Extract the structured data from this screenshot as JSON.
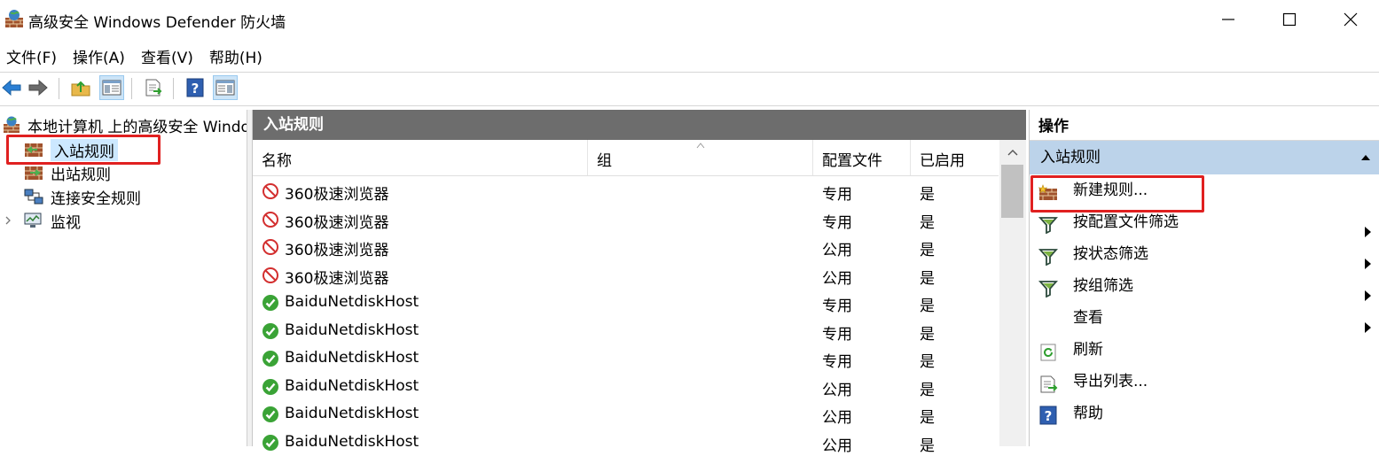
{
  "window": {
    "title": "高级安全 Windows Defender 防火墙"
  },
  "menu": [
    "文件(F)",
    "操作(A)",
    "查看(V)",
    "帮助(H)"
  ],
  "toolbar": {
    "buttons": [
      "back-icon",
      "forward-icon",
      "up-folder-icon",
      "show-hide-tree-icon",
      "export-list-icon",
      "help-icon",
      "show-hide-action-pane-icon"
    ]
  },
  "tree": {
    "root": "本地计算机 上的高级安全 Windows Defender 防火墙",
    "items": [
      {
        "label": "入站规则",
        "selected": true
      },
      {
        "label": "出站规则",
        "selected": false
      },
      {
        "label": "连接安全规则",
        "selected": false
      },
      {
        "label": "监视",
        "selected": false
      }
    ]
  },
  "main": {
    "header": "入站规则",
    "columns": [
      "名称",
      "组",
      "配置文件",
      "已启用"
    ],
    "rows": [
      {
        "name": "360极速浏览器",
        "group": "",
        "profile": "专用",
        "enabled": "是",
        "action": "block"
      },
      {
        "name": "360极速浏览器",
        "group": "",
        "profile": "专用",
        "enabled": "是",
        "action": "block"
      },
      {
        "name": "360极速浏览器",
        "group": "",
        "profile": "公用",
        "enabled": "是",
        "action": "block"
      },
      {
        "name": "360极速浏览器",
        "group": "",
        "profile": "公用",
        "enabled": "是",
        "action": "block"
      },
      {
        "name": "BaiduNetdiskHost",
        "group": "",
        "profile": "专用",
        "enabled": "是",
        "action": "allow"
      },
      {
        "name": "BaiduNetdiskHost",
        "group": "",
        "profile": "专用",
        "enabled": "是",
        "action": "allow"
      },
      {
        "name": "BaiduNetdiskHost",
        "group": "",
        "profile": "专用",
        "enabled": "是",
        "action": "allow"
      },
      {
        "name": "BaiduNetdiskHost",
        "group": "",
        "profile": "公用",
        "enabled": "是",
        "action": "allow"
      },
      {
        "name": "BaiduNetdiskHost",
        "group": "",
        "profile": "公用",
        "enabled": "是",
        "action": "allow"
      },
      {
        "name": "BaiduNetdiskHost",
        "group": "",
        "profile": "公用",
        "enabled": "是",
        "action": "allow"
      }
    ]
  },
  "actions": {
    "header": "操作",
    "section": "入站规则",
    "items": [
      {
        "label": "新建规则...",
        "icon": "new-rule-icon",
        "submenu": false
      },
      {
        "label": "按配置文件筛选",
        "icon": "filter-icon",
        "submenu": true
      },
      {
        "label": "按状态筛选",
        "icon": "filter-icon",
        "submenu": true
      },
      {
        "label": "按组筛选",
        "icon": "filter-icon",
        "submenu": true
      },
      {
        "label": "查看",
        "icon": "",
        "submenu": true
      },
      {
        "label": "刷新",
        "icon": "refresh-icon",
        "submenu": false
      },
      {
        "label": "导出列表...",
        "icon": "export-list-icon",
        "submenu": false
      },
      {
        "label": "帮助",
        "icon": "help-icon",
        "submenu": false
      }
    ]
  },
  "colors": {
    "highlight_box": "#e02020",
    "pane_header": "#6d6d6d",
    "action_section": "#bcd3ea",
    "selection": "#cce8ff"
  }
}
